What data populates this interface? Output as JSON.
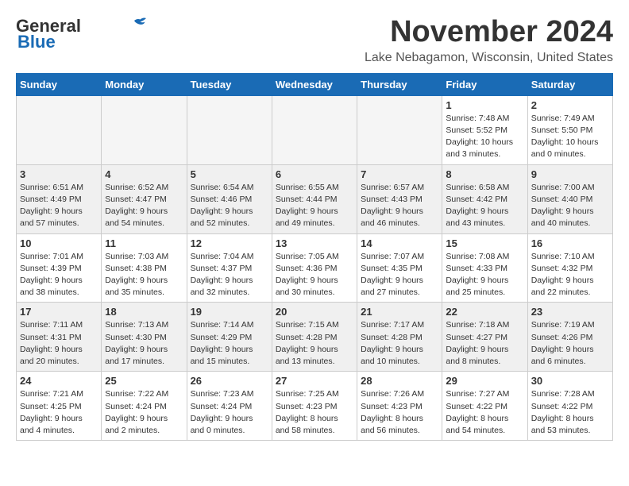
{
  "header": {
    "logo_line1": "General",
    "logo_line2": "Blue",
    "month_title": "November 2024",
    "location": "Lake Nebagamon, Wisconsin, United States"
  },
  "weekdays": [
    "Sunday",
    "Monday",
    "Tuesday",
    "Wednesday",
    "Thursday",
    "Friday",
    "Saturday"
  ],
  "weeks": [
    [
      {
        "day": "",
        "info": ""
      },
      {
        "day": "",
        "info": ""
      },
      {
        "day": "",
        "info": ""
      },
      {
        "day": "",
        "info": ""
      },
      {
        "day": "",
        "info": ""
      },
      {
        "day": "1",
        "info": "Sunrise: 7:48 AM\nSunset: 5:52 PM\nDaylight: 10 hours\nand 3 minutes."
      },
      {
        "day": "2",
        "info": "Sunrise: 7:49 AM\nSunset: 5:50 PM\nDaylight: 10 hours\nand 0 minutes."
      }
    ],
    [
      {
        "day": "3",
        "info": "Sunrise: 6:51 AM\nSunset: 4:49 PM\nDaylight: 9 hours\nand 57 minutes."
      },
      {
        "day": "4",
        "info": "Sunrise: 6:52 AM\nSunset: 4:47 PM\nDaylight: 9 hours\nand 54 minutes."
      },
      {
        "day": "5",
        "info": "Sunrise: 6:54 AM\nSunset: 4:46 PM\nDaylight: 9 hours\nand 52 minutes."
      },
      {
        "day": "6",
        "info": "Sunrise: 6:55 AM\nSunset: 4:44 PM\nDaylight: 9 hours\nand 49 minutes."
      },
      {
        "day": "7",
        "info": "Sunrise: 6:57 AM\nSunset: 4:43 PM\nDaylight: 9 hours\nand 46 minutes."
      },
      {
        "day": "8",
        "info": "Sunrise: 6:58 AM\nSunset: 4:42 PM\nDaylight: 9 hours\nand 43 minutes."
      },
      {
        "day": "9",
        "info": "Sunrise: 7:00 AM\nSunset: 4:40 PM\nDaylight: 9 hours\nand 40 minutes."
      }
    ],
    [
      {
        "day": "10",
        "info": "Sunrise: 7:01 AM\nSunset: 4:39 PM\nDaylight: 9 hours\nand 38 minutes."
      },
      {
        "day": "11",
        "info": "Sunrise: 7:03 AM\nSunset: 4:38 PM\nDaylight: 9 hours\nand 35 minutes."
      },
      {
        "day": "12",
        "info": "Sunrise: 7:04 AM\nSunset: 4:37 PM\nDaylight: 9 hours\nand 32 minutes."
      },
      {
        "day": "13",
        "info": "Sunrise: 7:05 AM\nSunset: 4:36 PM\nDaylight: 9 hours\nand 30 minutes."
      },
      {
        "day": "14",
        "info": "Sunrise: 7:07 AM\nSunset: 4:35 PM\nDaylight: 9 hours\nand 27 minutes."
      },
      {
        "day": "15",
        "info": "Sunrise: 7:08 AM\nSunset: 4:33 PM\nDaylight: 9 hours\nand 25 minutes."
      },
      {
        "day": "16",
        "info": "Sunrise: 7:10 AM\nSunset: 4:32 PM\nDaylight: 9 hours\nand 22 minutes."
      }
    ],
    [
      {
        "day": "17",
        "info": "Sunrise: 7:11 AM\nSunset: 4:31 PM\nDaylight: 9 hours\nand 20 minutes."
      },
      {
        "day": "18",
        "info": "Sunrise: 7:13 AM\nSunset: 4:30 PM\nDaylight: 9 hours\nand 17 minutes."
      },
      {
        "day": "19",
        "info": "Sunrise: 7:14 AM\nSunset: 4:29 PM\nDaylight: 9 hours\nand 15 minutes."
      },
      {
        "day": "20",
        "info": "Sunrise: 7:15 AM\nSunset: 4:28 PM\nDaylight: 9 hours\nand 13 minutes."
      },
      {
        "day": "21",
        "info": "Sunrise: 7:17 AM\nSunset: 4:28 PM\nDaylight: 9 hours\nand 10 minutes."
      },
      {
        "day": "22",
        "info": "Sunrise: 7:18 AM\nSunset: 4:27 PM\nDaylight: 9 hours\nand 8 minutes."
      },
      {
        "day": "23",
        "info": "Sunrise: 7:19 AM\nSunset: 4:26 PM\nDaylight: 9 hours\nand 6 minutes."
      }
    ],
    [
      {
        "day": "24",
        "info": "Sunrise: 7:21 AM\nSunset: 4:25 PM\nDaylight: 9 hours\nand 4 minutes."
      },
      {
        "day": "25",
        "info": "Sunrise: 7:22 AM\nSunset: 4:24 PM\nDaylight: 9 hours\nand 2 minutes."
      },
      {
        "day": "26",
        "info": "Sunrise: 7:23 AM\nSunset: 4:24 PM\nDaylight: 9 hours\nand 0 minutes."
      },
      {
        "day": "27",
        "info": "Sunrise: 7:25 AM\nSunset: 4:23 PM\nDaylight: 8 hours\nand 58 minutes."
      },
      {
        "day": "28",
        "info": "Sunrise: 7:26 AM\nSunset: 4:23 PM\nDaylight: 8 hours\nand 56 minutes."
      },
      {
        "day": "29",
        "info": "Sunrise: 7:27 AM\nSunset: 4:22 PM\nDaylight: 8 hours\nand 54 minutes."
      },
      {
        "day": "30",
        "info": "Sunrise: 7:28 AM\nSunset: 4:22 PM\nDaylight: 8 hours\nand 53 minutes."
      }
    ]
  ]
}
